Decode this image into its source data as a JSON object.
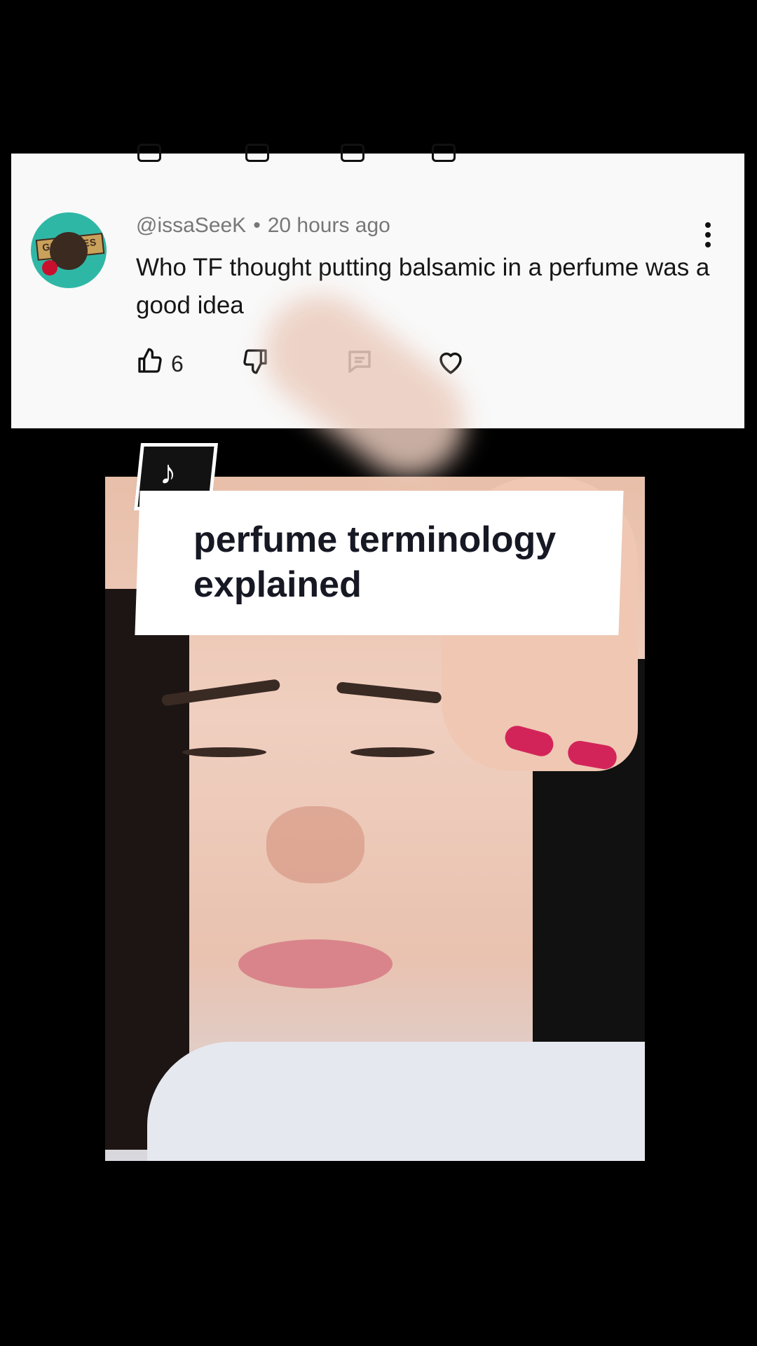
{
  "comment": {
    "username": "@issaSeeK",
    "separator": "•",
    "time": "20 hours ago",
    "text": "Who TF thought putting balsamic in a perfume was a good idea",
    "like_count": "6",
    "avatar_label": "GRIZZLIES"
  },
  "overlay": {
    "title": "perfume terminology explained"
  },
  "icons": {
    "like": "thumbs-up-icon",
    "dislike": "thumbs-down-icon",
    "reply": "comment-icon",
    "heart": "heart-icon",
    "more": "kebab-menu-icon",
    "brand": "tiktok-logo-icon"
  },
  "colors": {
    "card_bg": "#f9f9f9",
    "text": "#161616",
    "meta": "#777777",
    "avatar_bg": "#2fb7a6"
  }
}
